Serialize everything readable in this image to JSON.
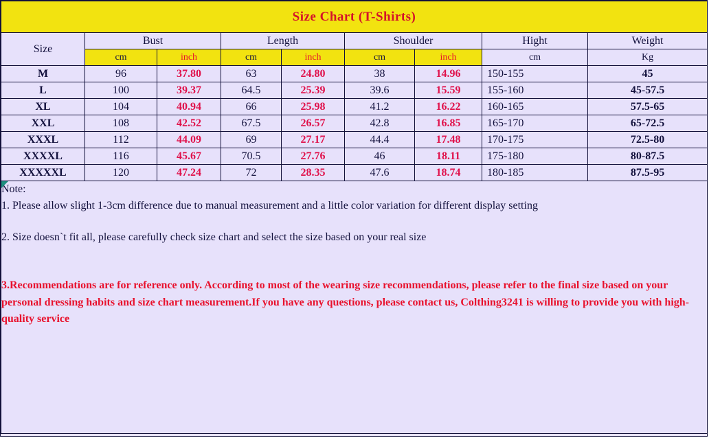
{
  "title": "Size Chart (T-Shirts)",
  "colors": {
    "title_bar": "#f2e310",
    "title_text": "#d4122a",
    "sheet_bg": "#e7e1fb",
    "grid": "#12103a",
    "inch_text": "#e0114b",
    "note_red": "#e8112d",
    "comment_flag": "#1d8f7e"
  },
  "table": {
    "group_headers": {
      "size": "Size",
      "bust": "Bust",
      "length": "Length",
      "shoulder": "Shoulder",
      "hight": "Hight",
      "weight": "Weight"
    },
    "unit_headers": {
      "bust_cm": "cm",
      "bust_inch": "inch",
      "length_cm": "cm",
      "length_inch": "inch",
      "shoulder_cm": "cm",
      "shoulder_inch": "inch",
      "hight_cm": "cm",
      "weight_kg": "Kg"
    },
    "rows": [
      {
        "size": "M",
        "bust_cm": "96",
        "bust_inch": "37.80",
        "length_cm": "63",
        "length_inch": "24.80",
        "shoulder_cm": "38",
        "shoulder_inch": "14.96",
        "hight": "150-155",
        "weight": "45"
      },
      {
        "size": "L",
        "bust_cm": "100",
        "bust_inch": "39.37",
        "length_cm": "64.5",
        "length_inch": "25.39",
        "shoulder_cm": "39.6",
        "shoulder_inch": "15.59",
        "hight": "155-160",
        "weight": "45-57.5"
      },
      {
        "size": "XL",
        "bust_cm": "104",
        "bust_inch": "40.94",
        "length_cm": "66",
        "length_inch": "25.98",
        "shoulder_cm": "41.2",
        "shoulder_inch": "16.22",
        "hight": "160-165",
        "weight": "57.5-65"
      },
      {
        "size": "XXL",
        "bust_cm": "108",
        "bust_inch": "42.52",
        "length_cm": "67.5",
        "length_inch": "26.57",
        "shoulder_cm": "42.8",
        "shoulder_inch": "16.85",
        "hight": "165-170",
        "weight": "65-72.5"
      },
      {
        "size": "XXXL",
        "bust_cm": "112",
        "bust_inch": "44.09",
        "length_cm": "69",
        "length_inch": "27.17",
        "shoulder_cm": "44.4",
        "shoulder_inch": "17.48",
        "hight": "170-175",
        "weight": "72.5-80"
      },
      {
        "size": "XXXXL",
        "bust_cm": "116",
        "bust_inch": "45.67",
        "length_cm": "70.5",
        "length_inch": "27.76",
        "shoulder_cm": "46",
        "shoulder_inch": "18.11",
        "hight": "175-180",
        "weight": "80-87.5"
      },
      {
        "size": "XXXXXL",
        "bust_cm": "120",
        "bust_inch": "47.24",
        "length_cm": "72",
        "length_inch": "28.35",
        "shoulder_cm": "47.6",
        "shoulder_inch": "18.74",
        "hight": "180-185",
        "weight": "87.5-95"
      }
    ]
  },
  "notes": {
    "heading": "Note:",
    "note1": "1. Please allow slight 1-3cm difference due to manual measurement and a little color variation for different display setting",
    "note2": "2. Size doesn`t fit all, please carefully check size chart and select the size based on your real size",
    "note3": "3.Recommendations are for reference only. According to most of the wearing size recommendations, please refer to the final size based on your personal dressing habits and size chart measurement.If you have any questions, please contact us, Colthing3241 is willing to provide you with high-quality service"
  }
}
